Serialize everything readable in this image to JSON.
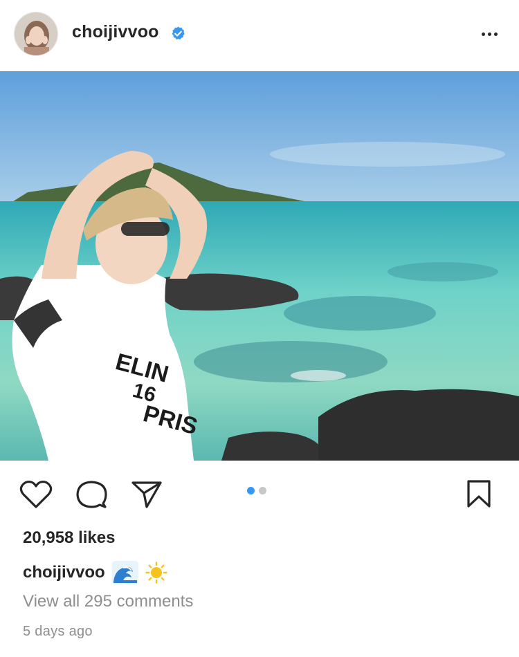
{
  "post": {
    "username": "choijivvoo",
    "verified": true,
    "more_icon": "more-horizontal-icon",
    "image_description_icon": "photo",
    "carousel": {
      "count": 2,
      "active": 1,
      "active_color": "#3897f0",
      "inactive_color": "#c7c7c7"
    },
    "likes_text": "20,958 likes",
    "caption": {
      "username": "choijivvoo",
      "emojis": [
        "wave-emoji",
        "sun-emoji"
      ]
    },
    "view_comments_text": "View all 295 comments",
    "time_ago": "5 days ago"
  },
  "icons": {
    "like": "heart-icon",
    "comment": "comment-icon",
    "share": "paper-plane-icon",
    "save": "bookmark-icon"
  },
  "colors": {
    "text": "#262626",
    "secondary_text": "#8e8e8e",
    "verified_blue": "#3897f0"
  }
}
